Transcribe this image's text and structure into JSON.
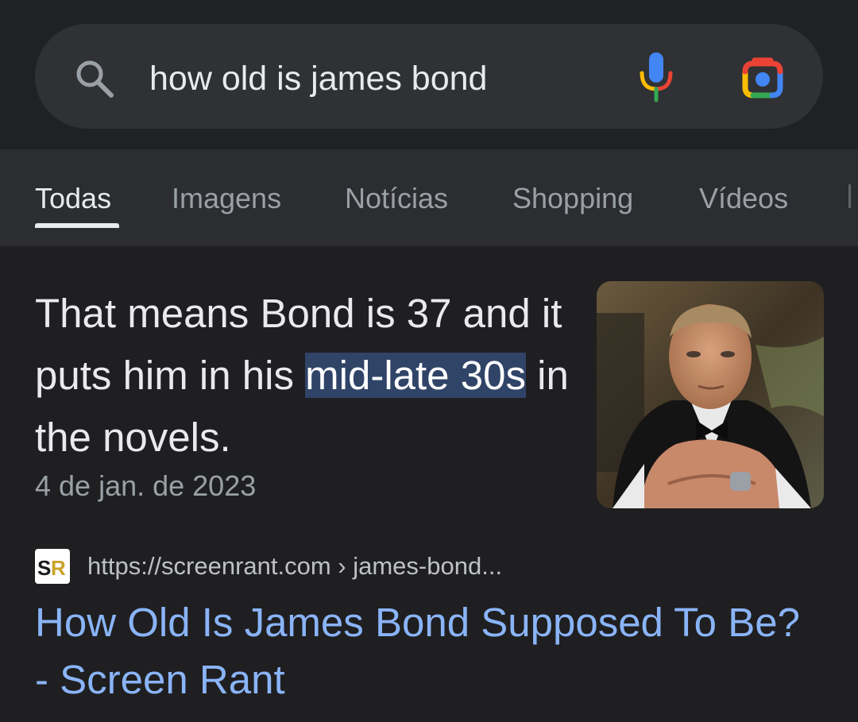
{
  "search": {
    "query": "how old is james bond"
  },
  "tabs": [
    {
      "label": "Todas",
      "active": true
    },
    {
      "label": "Imagens",
      "active": false
    },
    {
      "label": "Notícias",
      "active": false
    },
    {
      "label": "Shopping",
      "active": false
    },
    {
      "label": "Vídeos",
      "active": false
    }
  ],
  "snippet": {
    "text_before": "That means Bond is 37 and it puts him in his ",
    "highlight": "mid-late 30s",
    "text_after": " in the novels.",
    "date": "4 de jan. de 2023"
  },
  "result": {
    "favicon_text": "SR",
    "url": "https://screenrant.com › james-bond...",
    "title": "How Old Is James Bond Supposed To Be? - Screen Rant"
  },
  "icons": {
    "search": "search-icon",
    "mic": "mic-icon",
    "lens": "google-lens-icon"
  },
  "colors": {
    "link": "#8ab4f8",
    "highlight_bg": "#304468"
  }
}
